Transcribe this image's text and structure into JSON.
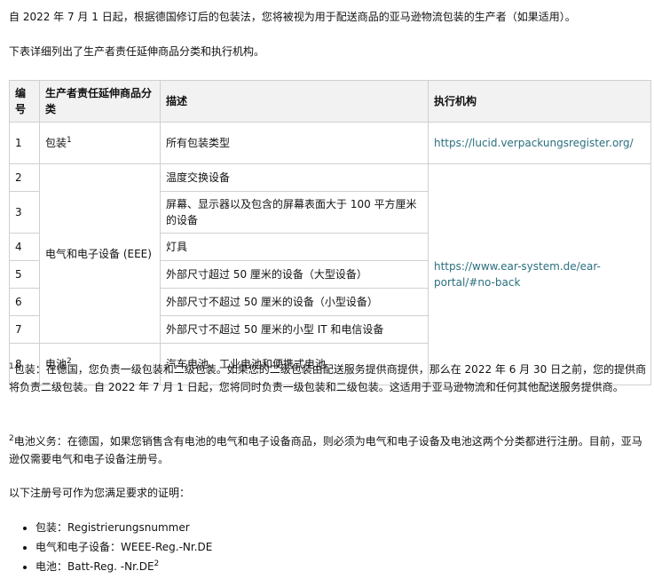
{
  "intro": "自 2022 年 7 月 1 日起，根据德国修订后的包装法，您将被视为用于配送商品的亚马逊物流包装的生产者（如果适用）。",
  "table_lead": "下表详细列出了生产者责任延伸商品分类和执行机构。",
  "table": {
    "headers": {
      "number": "编号",
      "category": "生产者责任延伸商品分类",
      "description": "描述",
      "authority": "执行机构"
    },
    "rows": [
      {
        "number": "1",
        "category": "包装",
        "category_sup": "1",
        "description": "所有包装类型",
        "authority": "https://lucid.verpackungsregister.org/"
      },
      {
        "number": "2",
        "description": "温度交换设备"
      },
      {
        "number": "3",
        "description": "屏幕、显示器以及包含的屏幕表面大于 100 平方厘米的设备"
      },
      {
        "number": "4",
        "category": "电气和电子设备 (EEE)",
        "description": "灯具",
        "authority": "https://www.ear-system.de/ear-portal/#no-back"
      },
      {
        "number": "5",
        "description": "外部尺寸超过 50 厘米的设备（大型设备）"
      },
      {
        "number": "6",
        "description": "外部尺寸不超过 50 厘米的设备（小型设备）"
      },
      {
        "number": "7",
        "description": "外部尺寸不超过 50 厘米的小型 IT 和电信设备"
      },
      {
        "number": "8",
        "category": "电池",
        "category_sup": "2",
        "description": "汽车电池、工业电池和便携式电池"
      }
    ]
  },
  "footnotes": {
    "packaging": {
      "sup": "1",
      "text": "包装：在德国，您负责一级包装和二级包装。如果您的二级包装由配送服务提供商提供，那么在 2022 年 6 月 30 日之前，您的提供商将负责二级包装。自 2022 年 7 月 1 日起，您将同时负责一级包装和二级包装。这适用于亚马逊物流和任何其他配送服务提供商。"
    },
    "battery": {
      "sup": "2",
      "text": "电池义务：在德国，如果您销售含有电池的电气和电子设备商品，则必须为电气和电子设备及电池这两个分类都进行注册。目前，亚马逊仅需要电气和电子设备注册号。"
    }
  },
  "proof_intro": "以下注册号可作为您满足要求的证明：",
  "registration_numbers": [
    {
      "label": "包装：",
      "value": "Registrierungsnummer",
      "sup": ""
    },
    {
      "label": "电气和电子设备：",
      "value": "WEEE-Reg.-Nr.DE",
      "sup": ""
    },
    {
      "label": "电池：",
      "value": "Batt-Reg. -Nr.DE",
      "sup": "2"
    }
  ],
  "colors": {
    "link": "#2a6f7e",
    "header_bg": "#f2f2f2",
    "border": "#d0d0d0"
  }
}
